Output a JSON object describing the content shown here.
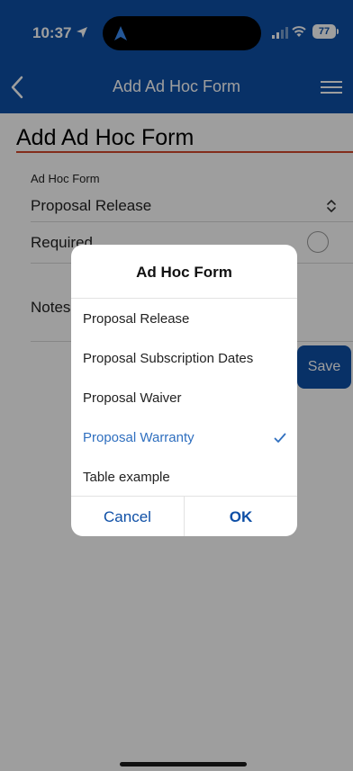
{
  "status_bar": {
    "time": "10:37",
    "battery": "77"
  },
  "header": {
    "title": "Add Ad Hoc Form"
  },
  "page": {
    "title": "Add Ad Hoc Form",
    "ad_hoc_form_label": "Ad Hoc Form",
    "ad_hoc_form_value": "Proposal Release",
    "required_label": "Required",
    "notes_label": "Notes",
    "save_label": "Save"
  },
  "dialog": {
    "title": "Ad Hoc Form",
    "options": [
      {
        "label": "Proposal Release",
        "selected": false
      },
      {
        "label": "Proposal Subscription Dates",
        "selected": false
      },
      {
        "label": "Proposal Waiver",
        "selected": false
      },
      {
        "label": "Proposal Warranty",
        "selected": true
      },
      {
        "label": "Table example",
        "selected": false
      }
    ],
    "cancel_label": "Cancel",
    "ok_label": "OK"
  },
  "colors": {
    "brand_blue": "#0e4fa6",
    "accent_red": "#d4482c",
    "selected_blue": "#2f6fbf"
  },
  "icons": [
    "location-arrow-icon",
    "navigation-arrow-icon",
    "signal-icon",
    "wifi-icon",
    "battery-icon",
    "back-chevron-icon",
    "hamburger-menu-icon",
    "select-chevron-icon",
    "checkmark-icon"
  ]
}
